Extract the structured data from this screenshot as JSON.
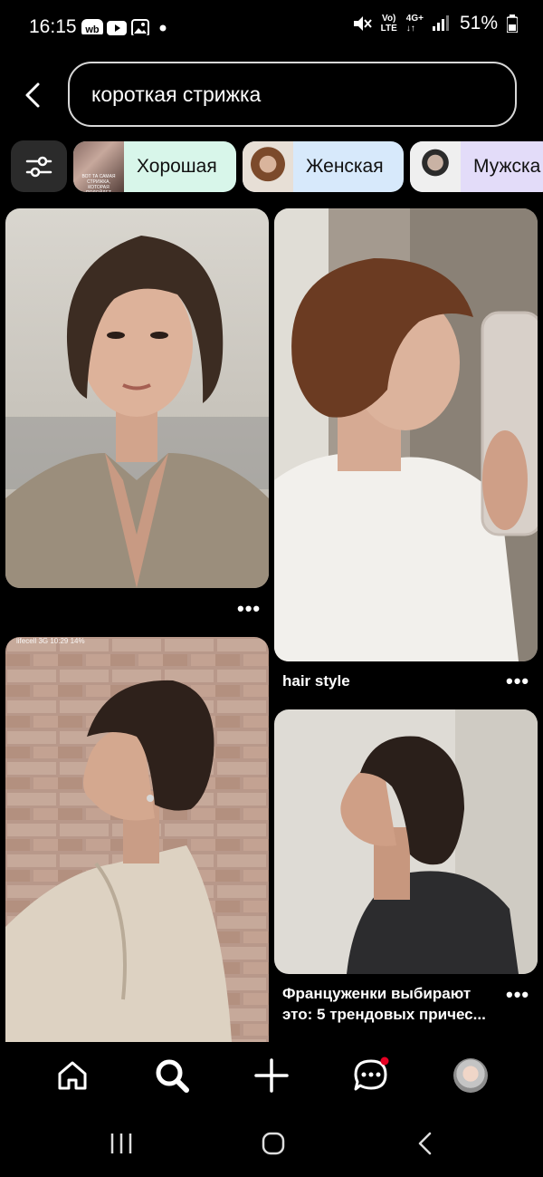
{
  "status_bar": {
    "time": "16:15",
    "network_label_top": "Vo)",
    "network_label_bottom": "LTE",
    "network_type": "4G+",
    "battery": "51%",
    "icons": [
      "wb-icon",
      "youtube-icon",
      "gallery-icon",
      "dot-icon",
      "mute-icon",
      "signal-icon",
      "battery-icon"
    ]
  },
  "search": {
    "query": "короткая стрижка"
  },
  "filter_chips": [
    {
      "label": "Хорошая",
      "bg": "#d8f6ea",
      "thumb_text": "ВОТ ТА САМАЯ СТРИЖКА, КОТОРАЯ ПОДОЙДЕТ"
    },
    {
      "label": "Женская",
      "bg": "#d7e9fb",
      "thumb_text": ""
    },
    {
      "label": "Мужска",
      "bg": "#e3dcf9",
      "thumb_text": ""
    }
  ],
  "pins": {
    "left": [
      {
        "title": "",
        "more": "•••"
      },
      {
        "title": "",
        "overlay_status": "lifecell 3G   10:29   14%"
      }
    ],
    "right": [
      {
        "title": "hair style",
        "more": "•••"
      },
      {
        "title": "Француженки выбирают это: 5 трендовых причес...",
        "more": "•••"
      }
    ]
  },
  "bottom_nav": {
    "items": [
      "home-icon",
      "search-icon",
      "create-icon",
      "messages-icon",
      "profile-avatar"
    ],
    "active": "search-icon",
    "notification_color": "#e60023"
  },
  "system_nav": [
    "recent-apps-icon",
    "home-circle-icon",
    "back-icon"
  ]
}
